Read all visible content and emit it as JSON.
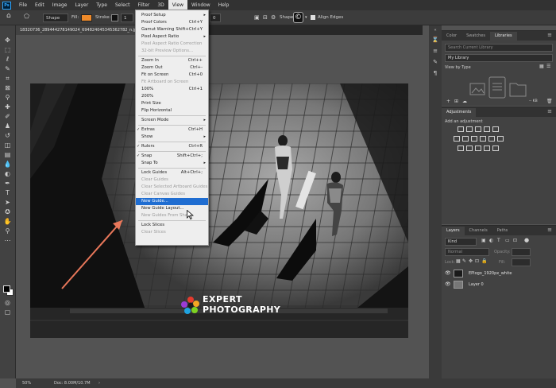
{
  "menubar": {
    "items": [
      "File",
      "Edit",
      "Image",
      "Layer",
      "Type",
      "Select",
      "Filter",
      "3D",
      "View",
      "Window",
      "Help"
    ],
    "active": "View"
  },
  "options": {
    "mode": "Shape",
    "fill_label": "Fill:",
    "stroke_label": "Stroke:",
    "stroke_width": "1 px",
    "width_value": "0 px",
    "shape_label": "Shape:",
    "align_edges": "Align Edges",
    "fill_color": "#ee8a2a"
  },
  "document": {
    "tab_title": "18320736_289444278149024_694824045345362782_n.jpg @"
  },
  "view_menu": {
    "items": [
      {
        "label": "Proof Setup",
        "submenu": true
      },
      {
        "label": "Proof Colors",
        "shortcut": "Ctrl+Y"
      },
      {
        "label": "Gamut Warning",
        "shortcut": "Shift+Ctrl+Y"
      },
      {
        "label": "Pixel Aspect Ratio",
        "submenu": true
      },
      {
        "label": "Pixel Aspect Ratio Correction",
        "disabled": true
      },
      {
        "label": "32-bit Preview Options...",
        "disabled": true
      },
      {
        "sep": true
      },
      {
        "label": "Zoom In",
        "shortcut": "Ctrl++"
      },
      {
        "label": "Zoom Out",
        "shortcut": "Ctrl+-"
      },
      {
        "label": "Fit on Screen",
        "shortcut": "Ctrl+0"
      },
      {
        "label": "Fit Artboard on Screen",
        "disabled": true
      },
      {
        "label": "100%",
        "shortcut": "Ctrl+1"
      },
      {
        "label": "200%"
      },
      {
        "label": "Print Size"
      },
      {
        "label": "Flip Horizontal"
      },
      {
        "sep": true
      },
      {
        "label": "Screen Mode",
        "submenu": true
      },
      {
        "sep": true
      },
      {
        "label": "Extras",
        "shortcut": "Ctrl+H",
        "checked": true
      },
      {
        "label": "Show",
        "submenu": true
      },
      {
        "sep": true
      },
      {
        "label": "Rulers",
        "shortcut": "Ctrl+R",
        "checked": true
      },
      {
        "sep": true
      },
      {
        "label": "Snap",
        "shortcut": "Shift+Ctrl+;",
        "checked": true
      },
      {
        "label": "Snap To",
        "submenu": true
      },
      {
        "sep": true
      },
      {
        "label": "Lock Guides",
        "shortcut": "Alt+Ctrl+;"
      },
      {
        "label": "Clear Guides",
        "disabled": true
      },
      {
        "label": "Clear Selected Artboard Guides",
        "disabled": true
      },
      {
        "label": "Clear Canvas Guides",
        "disabled": true
      },
      {
        "label": "New Guide...",
        "highlighted": true
      },
      {
        "label": "New Guide Layout..."
      },
      {
        "label": "New Guides From Shape",
        "disabled": true
      },
      {
        "sep": true
      },
      {
        "label": "Lock Slices"
      },
      {
        "label": "Clear Slices",
        "disabled": true
      }
    ]
  },
  "libraries_panel": {
    "tabs": [
      "Color",
      "Swatches",
      "Libraries"
    ],
    "active_tab": "Libraries",
    "search_placeholder": "Search Current Library",
    "library_name": "My Library",
    "view_by": "View by Type",
    "size_label": "-- KB"
  },
  "adjustments_panel": {
    "title": "Adjustments",
    "subtitle": "Add an adjustment"
  },
  "layers_panel": {
    "tabs": [
      "Layers",
      "Channels",
      "Paths"
    ],
    "active_tab": "Layers",
    "filter_kind": "Kind",
    "blend_mode": "Normal",
    "opacity_label": "Opacity:",
    "lock_label": "Lock:",
    "fill_label": "Fill:",
    "layers": [
      {
        "name": "EPlogo_1920px_white"
      },
      {
        "name": "Layer 0"
      }
    ]
  },
  "watermark": {
    "line1": "EXPERT",
    "line2": "PHOTOGRAPHY"
  },
  "status": {
    "zoom": "50%",
    "doc": "Doc: 8.00M/10.7M"
  }
}
